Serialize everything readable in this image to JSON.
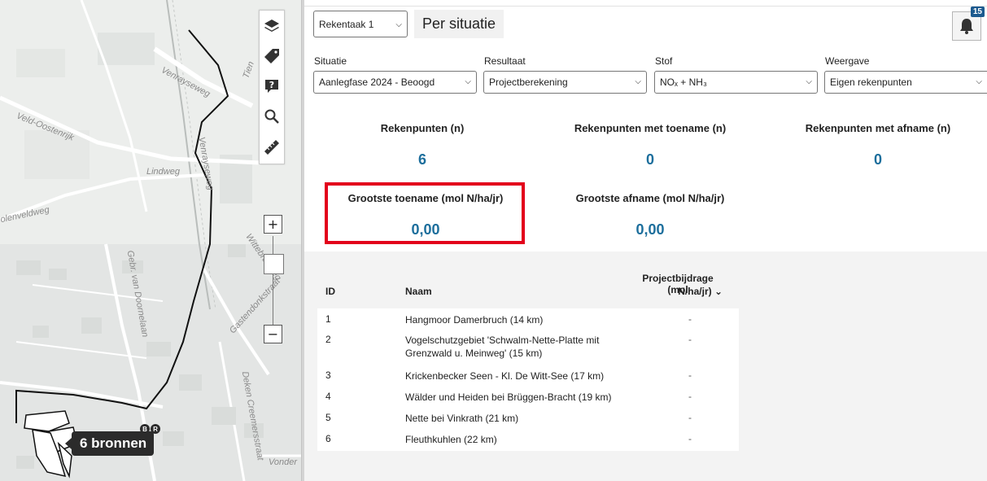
{
  "map": {
    "labels": {
      "venrayseweg_1": "Venrayseweg",
      "venrayseweg_2": "Venrayseweg",
      "veld_oostenrijk": "Veld-Oostenrijk",
      "lindweg": "Lindweg",
      "molenveldweg": "olenveldweg",
      "wittebrugweg": "Wittebrugweg",
      "gebr_van_doornelaan": "Gebr. van Doornelaan",
      "gastendonkstraat": "Gastendonkstraat",
      "deken_creemersstraat": "Deken Creemersstraat",
      "vonder": "Vonder",
      "tien": "Tien"
    },
    "zoom_in": "+",
    "zoom_out": "−",
    "sources_label": "6 bronnen",
    "pill_b": "B",
    "pill_r": "R",
    "icons": [
      "layers-icon",
      "tag-icon",
      "comment-question-icon",
      "search-icon",
      "measure-icon"
    ]
  },
  "header": {
    "calc_task": "Rekentaak 1",
    "tab": "Per situatie",
    "notifications_count": "15"
  },
  "filters": {
    "situatie": {
      "label": "Situatie",
      "value": "Aanlegfase 2024 - Beoogd"
    },
    "resultaat": {
      "label": "Resultaat",
      "value": "Projectberekening"
    },
    "stof": {
      "label": "Stof",
      "value": "NOₓ + NH₃"
    },
    "weergave": {
      "label": "Weergave",
      "value": "Eigen rekenpunten"
    }
  },
  "stats": {
    "rekenpunten": {
      "title": "Rekenpunten (n)",
      "value": "6"
    },
    "toename": {
      "title": "Rekenpunten met toename (n)",
      "value": "0"
    },
    "afname": {
      "title": "Rekenpunten met afname (n)",
      "value": "0"
    },
    "grootste_toename": {
      "title": "Grootste toename (mol N/ha/jr)",
      "value": "0,00"
    },
    "grootste_afname": {
      "title": "Grootste afname (mol N/ha/jr)",
      "value": "0,00"
    }
  },
  "table": {
    "headers": {
      "id": "ID",
      "naam": "Naam",
      "bijdrage_1": "Projectbijdrage (mol",
      "bijdrage_2": "N/ha/jr) ⌄"
    },
    "rows": [
      {
        "id": "1",
        "name": "Hangmoor Damerbruch (14 km)",
        "value": "-"
      },
      {
        "id": "2",
        "name": "Vogelschutzgebiet 'Schwalm-Nette-Platte mit Grenzwald u. Meinweg' (15 km)",
        "value": "-"
      },
      {
        "id": "3",
        "name": "Krickenbecker Seen - Kl. De Witt-See (17 km)",
        "value": "-"
      },
      {
        "id": "4",
        "name": "Wälder und Heiden bei Brüggen-Bracht (19 km)",
        "value": "-"
      },
      {
        "id": "5",
        "name": "Nette bei Vinkrath (21 km)",
        "value": "-"
      },
      {
        "id": "6",
        "name": "Fleuthkuhlen (22 km)",
        "value": "-"
      }
    ]
  }
}
